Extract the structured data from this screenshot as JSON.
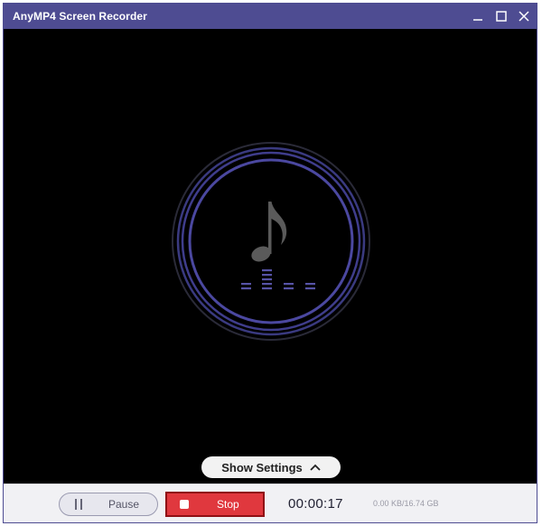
{
  "window": {
    "title": "AnyMP4 Screen Recorder",
    "controls": [
      "minimize-icon",
      "maximize-icon",
      "close-icon"
    ]
  },
  "visual": {
    "icon": "music-note-icon",
    "equalizer_icon": "equalizer-icon"
  },
  "settings": {
    "label": "Show Settings",
    "icon": "chevron-up-icon"
  },
  "recording": {
    "pause_label": "Pause",
    "stop_label": "Stop",
    "elapsed": "00:00:17",
    "storage": "0.00 KB/16.74 GB"
  },
  "colors": {
    "titlebar": "#4e4c92",
    "ring": "#3f3d8c",
    "stop": "#e0383e",
    "equalizer": "#5653a6"
  }
}
